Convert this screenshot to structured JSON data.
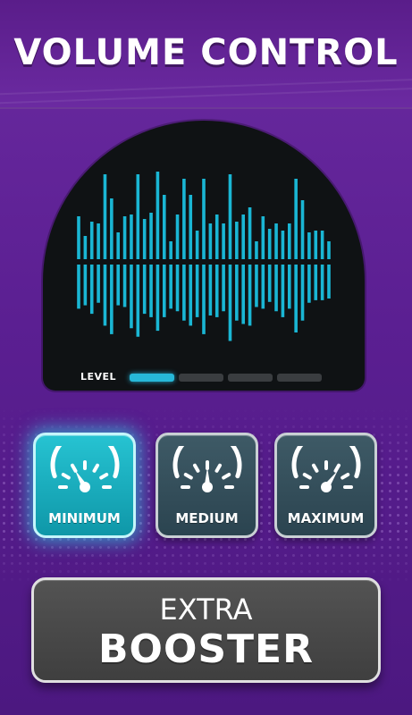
{
  "header": {
    "title": "VOLUME CONTROL"
  },
  "visualizer": {
    "level_label": "LEVEL",
    "level_segments": 4,
    "active_level": 1,
    "bar_color": "#1ab6d4",
    "bar_heights_up": [
      0.48,
      0.26,
      0.42,
      0.4,
      0.95,
      0.68,
      0.3,
      0.48,
      0.5,
      0.95,
      0.45,
      0.52,
      0.98,
      0.72,
      0.2,
      0.5,
      0.9,
      0.72,
      0.32,
      0.9,
      0.4,
      0.5,
      0.4,
      0.95,
      0.42,
      0.5,
      0.58,
      0.2,
      0.48,
      0.34,
      0.4,
      0.32,
      0.4,
      0.9,
      0.66,
      0.3,
      0.32,
      0.32,
      0.2
    ],
    "bar_heights_down": [
      0.52,
      0.48,
      0.58,
      0.45,
      0.72,
      0.82,
      0.48,
      0.5,
      0.75,
      0.85,
      0.58,
      0.62,
      0.78,
      0.62,
      0.52,
      0.55,
      0.66,
      0.72,
      0.62,
      0.82,
      0.6,
      0.62,
      0.55,
      0.9,
      0.66,
      0.7,
      0.72,
      0.5,
      0.52,
      0.44,
      0.55,
      0.62,
      0.52,
      0.8,
      0.66,
      0.45,
      0.42,
      0.42,
      0.4
    ]
  },
  "modes": [
    {
      "label": "MINIMUM",
      "active": true,
      "needle_angle": 120
    },
    {
      "label": "MEDIUM",
      "active": false,
      "needle_angle": 90
    },
    {
      "label": "MAXIMUM",
      "active": false,
      "needle_angle": 55
    }
  ],
  "booster": {
    "line1": "EXTRA",
    "line2": "BOOSTER"
  },
  "colors": {
    "accent": "#26c3d2",
    "level_active": "#27b8d8",
    "level_inactive": "#3a3d40",
    "background": "#5b1f92"
  }
}
